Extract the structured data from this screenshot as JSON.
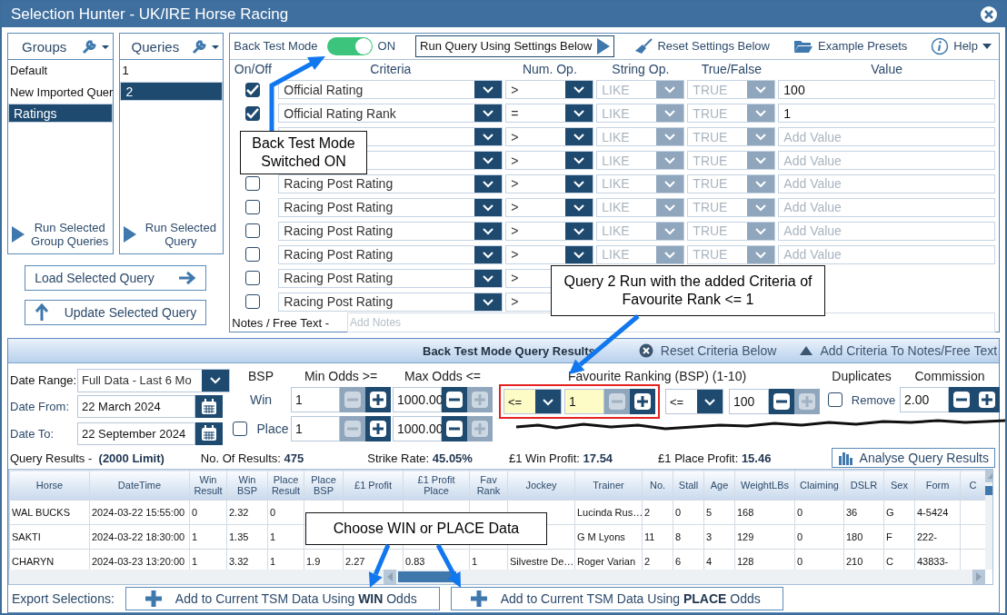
{
  "window": {
    "title": "Selection Hunter - UK/IRE Horse Racing"
  },
  "groups": {
    "title": "Groups",
    "run_button": "Run Selected Group Queries",
    "items": [
      {
        "label": "Default",
        "selected": false
      },
      {
        "label": "New Imported Quer",
        "selected": false
      },
      {
        "label": "Ratings",
        "selected": true
      }
    ]
  },
  "queries": {
    "title": "Queries",
    "run_button": "Run Selected Query",
    "items": [
      {
        "label": "1",
        "selected": false
      },
      {
        "label": "2",
        "selected": true
      }
    ]
  },
  "load_button": "Load Selected Query",
  "update_button": "Update Selected Query",
  "toolbar": {
    "back_test_label": "Back Test Mode",
    "back_test_on": true,
    "back_test_state": "ON",
    "run_button": "Run Query Using Settings Below",
    "reset": "Reset Settings Below",
    "presets": "Example Presets",
    "help": "Help"
  },
  "criteria": {
    "columns": [
      "On/Off",
      "Criteria",
      "Num. Op.",
      "String Op.",
      "True/False",
      "Value"
    ],
    "string_op_disabled": true,
    "true_false_disabled": true,
    "rows": [
      {
        "checked": true,
        "criteria": "Official Rating",
        "num_op": ">",
        "string_op": "LIKE",
        "true_false": "TRUE",
        "value": "100"
      },
      {
        "checked": true,
        "criteria": "Official Rating Rank",
        "num_op": "=",
        "string_op": "LIKE",
        "true_false": "TRUE",
        "value": "1"
      },
      {
        "num_op": ">",
        "string_op": "LIKE",
        "true_false": "TRUE",
        "placeholder": "Add Value"
      },
      {
        "num_op": ">",
        "string_op": "LIKE",
        "true_false": "TRUE",
        "placeholder": "Add Value"
      },
      {
        "checked": false,
        "criteria": "Racing Post Rating",
        "num_op": ">",
        "string_op": "LIKE",
        "true_false": "TRUE",
        "placeholder": "Add Value"
      },
      {
        "checked": false,
        "criteria": "Racing Post Rating",
        "num_op": ">",
        "string_op": "LIKE",
        "true_false": "TRUE",
        "placeholder": "Add Value"
      },
      {
        "checked": false,
        "criteria": "Racing Post Rating",
        "num_op": ">",
        "string_op": "LIKE",
        "true_false": "TRUE",
        "placeholder": "Add Value"
      },
      {
        "checked": false,
        "criteria": "Racing Post Rating",
        "num_op": ">",
        "string_op": "LIKE",
        "true_false": "TRUE",
        "placeholder": "Add Value"
      },
      {
        "checked": false,
        "criteria": "Racing Post Rating",
        "num_op": ">"
      },
      {
        "checked": false,
        "criteria": "Racing Post Rating",
        "num_op": ">"
      }
    ],
    "notes_label": "Notes / Free Text -",
    "notes_placeholder": "Add Notes"
  },
  "results_panel": {
    "title": "Back Test Mode Query Results",
    "reset": "Reset Criteria Below",
    "add_criteria": "Add Criteria To Notes/Free Text"
  },
  "filters": {
    "date_range_label": "Date Range:",
    "date_range": "Full Data - Last 6 Mo",
    "date_from_label": "Date From:",
    "date_from": "22 March 2024",
    "date_to_label": "Date To:",
    "date_to": "22 September 2024",
    "bsp_label": "BSP",
    "win_label": "Win",
    "place_label": "Place",
    "place_checked": false,
    "min_label": "Min Odds >=",
    "max_label": "Max Odds <=",
    "min_win": {
      "value": "1",
      "minus_disabled": true,
      "plus_disabled": false
    },
    "max_win": {
      "value": "1000.00",
      "minus_disabled": false,
      "plus_disabled": true
    },
    "min_place": {
      "value": "1",
      "minus_disabled": true,
      "plus_disabled": false
    },
    "max_place": {
      "value": "1000.00",
      "minus_disabled": false,
      "plus_disabled": true
    },
    "fav_label": "Favourite Ranking (BSP) (1-10)",
    "fav_op_1": "<=",
    "fav_1": {
      "value": "1",
      "minus_disabled": true,
      "plus_disabled": false
    },
    "fav_op_2": "<=",
    "fav_2": {
      "value": "100",
      "minus_disabled": false,
      "plus_disabled": true
    },
    "duplicates_label": "Duplicates",
    "remove_label": "Remove",
    "remove_checked": false,
    "commission_label": "Commission",
    "commission": {
      "value": "2.00",
      "minus_disabled": false,
      "plus_disabled": false
    }
  },
  "summary": {
    "label": "Query Results -",
    "limit": "(2000 Limit)",
    "results_label": "No. Of Results:",
    "results": "475",
    "strike_label": "Strike Rate:",
    "strike": "45.05%",
    "win_label": "£1 Win Profit:",
    "win": "17.54",
    "place_label": "£1 Place Profit:",
    "place": "15.46",
    "analyse_button": "Analyse Query Results"
  },
  "table": {
    "columns": [
      "Horse",
      "DateTime",
      "Win Result",
      "Win BSP",
      "Place Result",
      "Place BSP",
      "£1 Profit",
      "£1 Profit Place",
      "Fav Rank",
      "Jockey",
      "Trainer",
      "No.",
      "Stall",
      "Age",
      "WeightLBs",
      "Claiming",
      "DSLR",
      "Sex",
      "Form",
      "C"
    ],
    "rows": [
      {
        "cells": [
          "WAL BUCKS",
          "2024-03-22 15:55:00",
          "0",
          "2.32",
          "0",
          null,
          null,
          null,
          null,
          null,
          "Lucinda Rus…",
          "2",
          "0",
          "5",
          "168",
          "0",
          "36",
          "G",
          "4-5424",
          null
        ]
      },
      {
        "cells": [
          "SAKTI",
          "2024-03-22 18:30:00",
          "1",
          "1.35",
          "1",
          null,
          null,
          null,
          null,
          null,
          "G M Lyons",
          "11",
          "8",
          "3",
          "129",
          "0",
          "180",
          "F",
          "222-",
          null
        ]
      },
      {
        "cells": [
          "CHARYN",
          "2024-03-23 13:20:00",
          "1",
          "3.32",
          "1",
          "1.9",
          "2.27",
          "0.83",
          "1",
          "Silvestre De…",
          "Roger Varian",
          "2",
          "6",
          "4",
          "128",
          "0",
          "210",
          "C",
          "43833-",
          null
        ]
      }
    ]
  },
  "export": {
    "label": "Export Selections:",
    "buttons": [
      "Add to Current TSM Data Using **WIN** Odds",
      "Add to Current TSM Data Using **PLACE** Odds"
    ]
  },
  "annotations": [
    {
      "text": "Back Test Mode Switched ON"
    },
    {
      "text": "Query 2 Run with the added Criteria of Favourite Rank <= 1"
    },
    {
      "text": "Choose WIN or PLACE Data"
    }
  ]
}
